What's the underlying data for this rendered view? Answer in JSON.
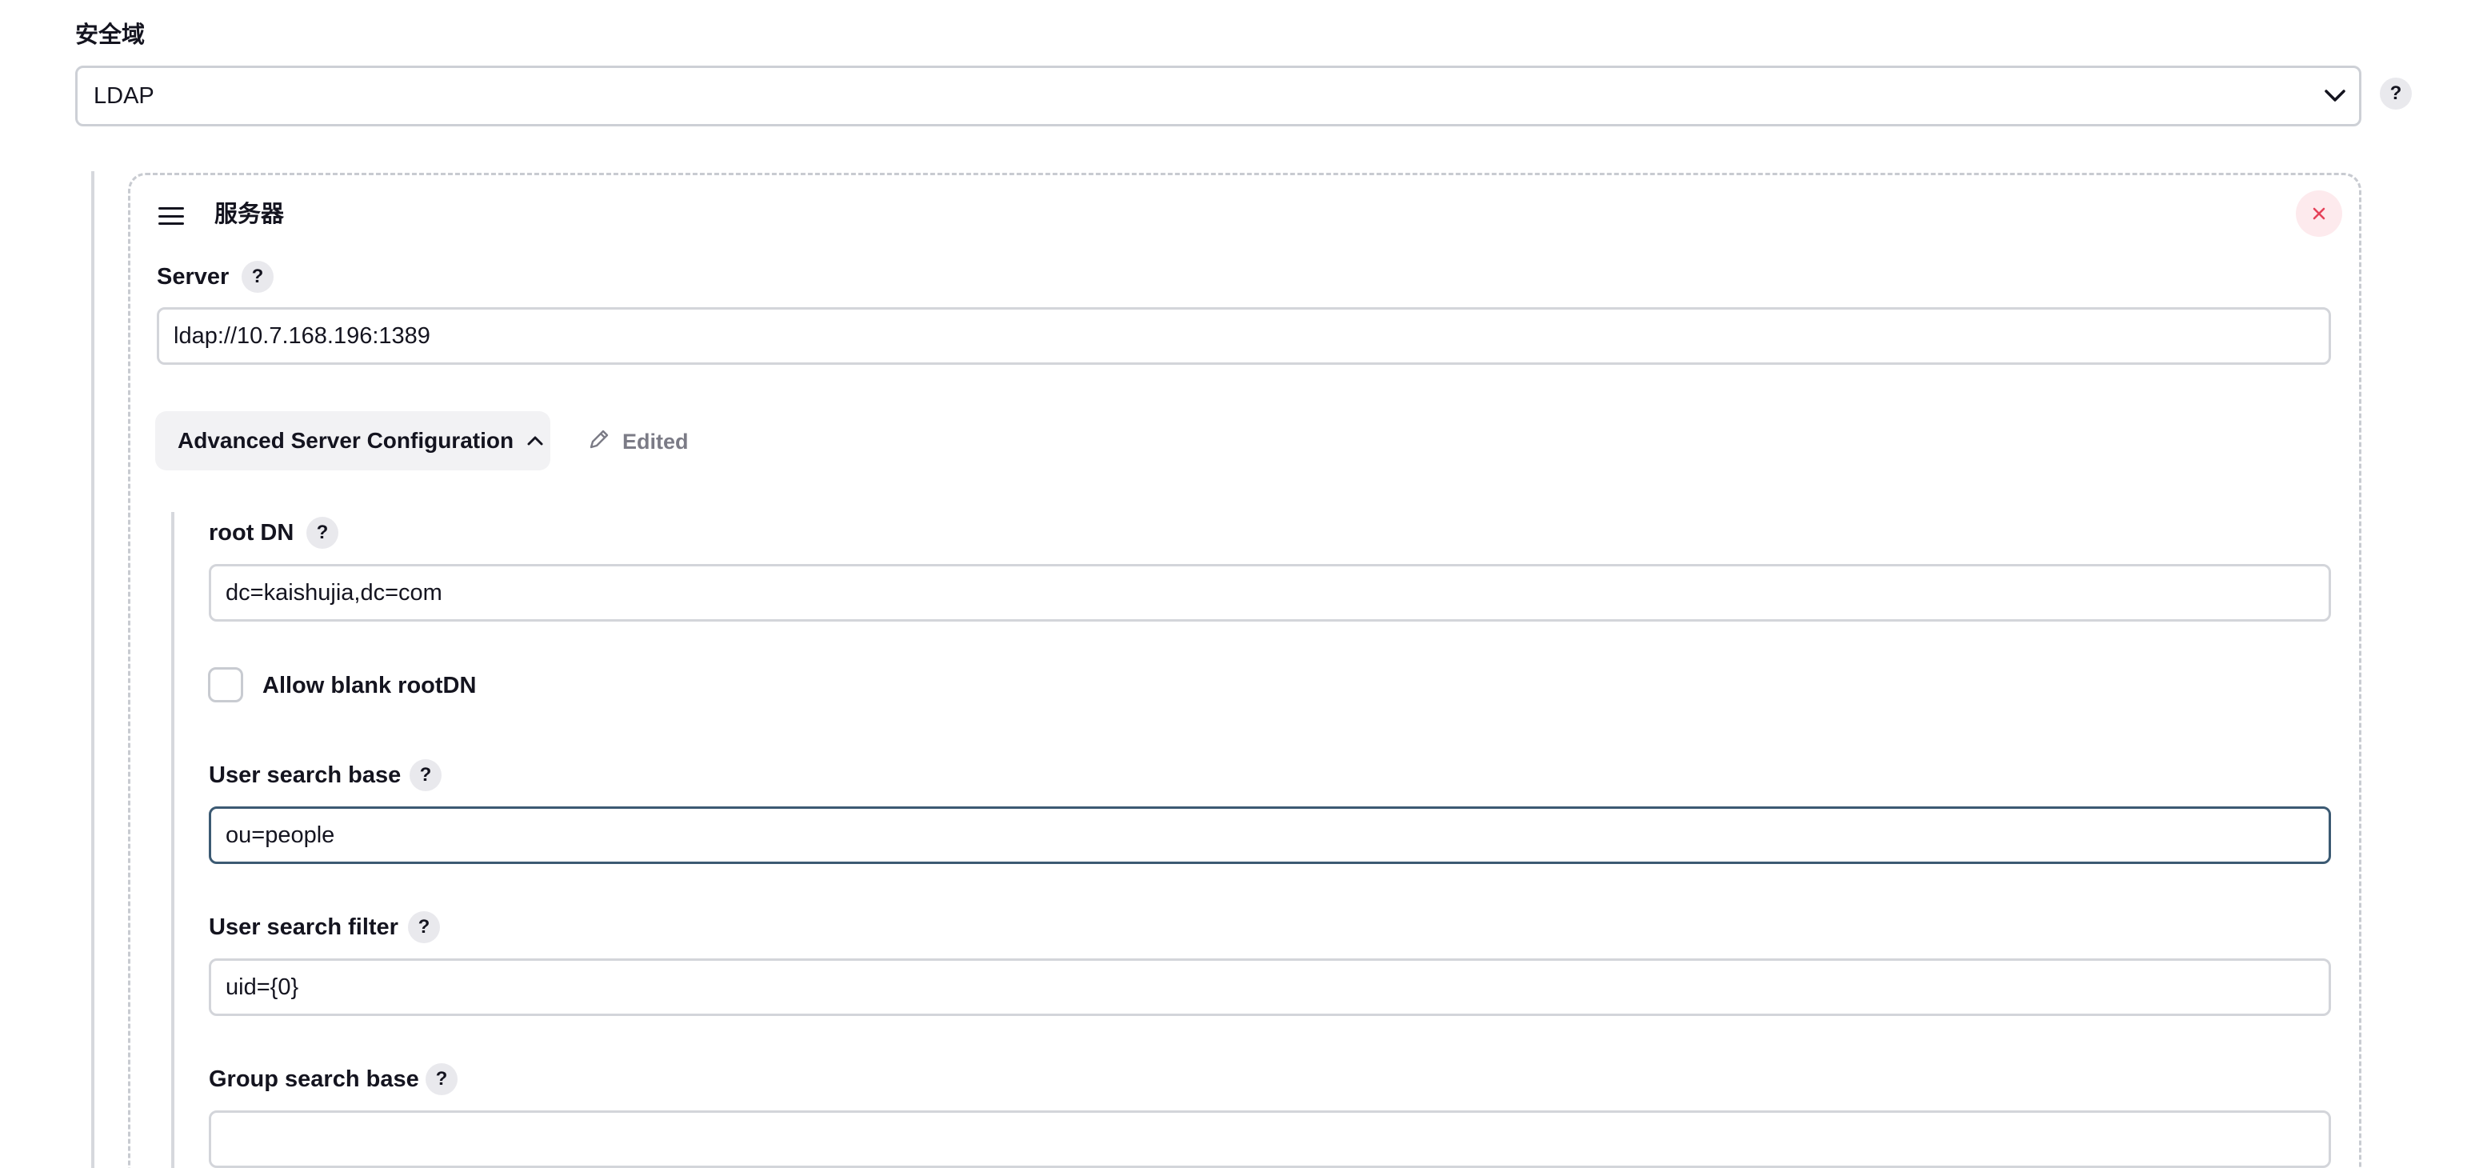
{
  "security_realm": {
    "label": "安全域",
    "selected": "LDAP",
    "help_label": "?"
  },
  "server_block": {
    "title": "服务器",
    "server": {
      "label": "Server",
      "help_label": "?",
      "value": "ldap://10.7.168.196:1389"
    },
    "advanced": {
      "button_label": "Advanced Server Configuration",
      "edited_label": "Edited"
    },
    "root_dn": {
      "label": "root DN",
      "help_label": "?",
      "value": "dc=kaishujia,dc=com"
    },
    "allow_blank_root_dn": {
      "label": "Allow blank rootDN",
      "checked": false
    },
    "user_search_base": {
      "label": "User search base",
      "help_label": "?",
      "value": "ou=people"
    },
    "user_search_filter": {
      "label": "User search filter",
      "help_label": "?",
      "value": "uid={0}"
    },
    "group_search_base": {
      "label": "Group search base",
      "help_label": "?",
      "value": ""
    }
  },
  "icons": {
    "select_chevron": "chevron-down-icon",
    "drag_handle": "drag-handle-icon",
    "close": "close-icon",
    "advanced_chevron": "chevron-up-icon",
    "edited": "pencil-icon"
  },
  "colors": {
    "close_icon": "#e5425a",
    "close_bg": "#fdeaed",
    "focus_border": "#3c5a73"
  }
}
